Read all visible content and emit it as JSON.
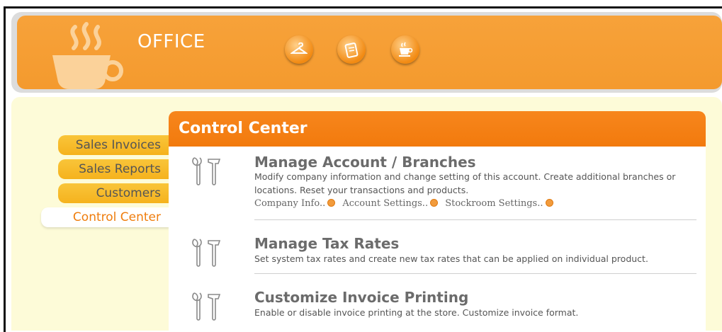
{
  "header": {
    "title": "OFFICE",
    "icons": [
      "hanger-icon",
      "clipboard-icon",
      "coffee-cup-icon"
    ],
    "brand_color": "#f49a2e"
  },
  "sidebar": {
    "items": [
      {
        "label": "Sales Invoices",
        "active": false
      },
      {
        "label": "Sales Reports",
        "active": false
      },
      {
        "label": "Customers",
        "active": false
      },
      {
        "label": "Control Center",
        "active": true
      }
    ]
  },
  "panel": {
    "title": "Control Center",
    "sections": [
      {
        "icon": "tools-icon",
        "title": "Manage Account / Branches",
        "desc": "Modify company information and change setting of this account. Create additional branches or locations. Reset your transactions and products.",
        "links": [
          "Company Info..",
          "Account Settings..",
          "Stockroom Settings.."
        ]
      },
      {
        "icon": "tools-icon",
        "title": "Manage Tax Rates",
        "desc": "Set system tax rates and create new tax rates that can be applied on individual product."
      },
      {
        "icon": "tools-icon",
        "title": "Customize Invoice Printing",
        "desc": "Enable or disable invoice printing at the store. Customize invoice format."
      }
    ]
  }
}
